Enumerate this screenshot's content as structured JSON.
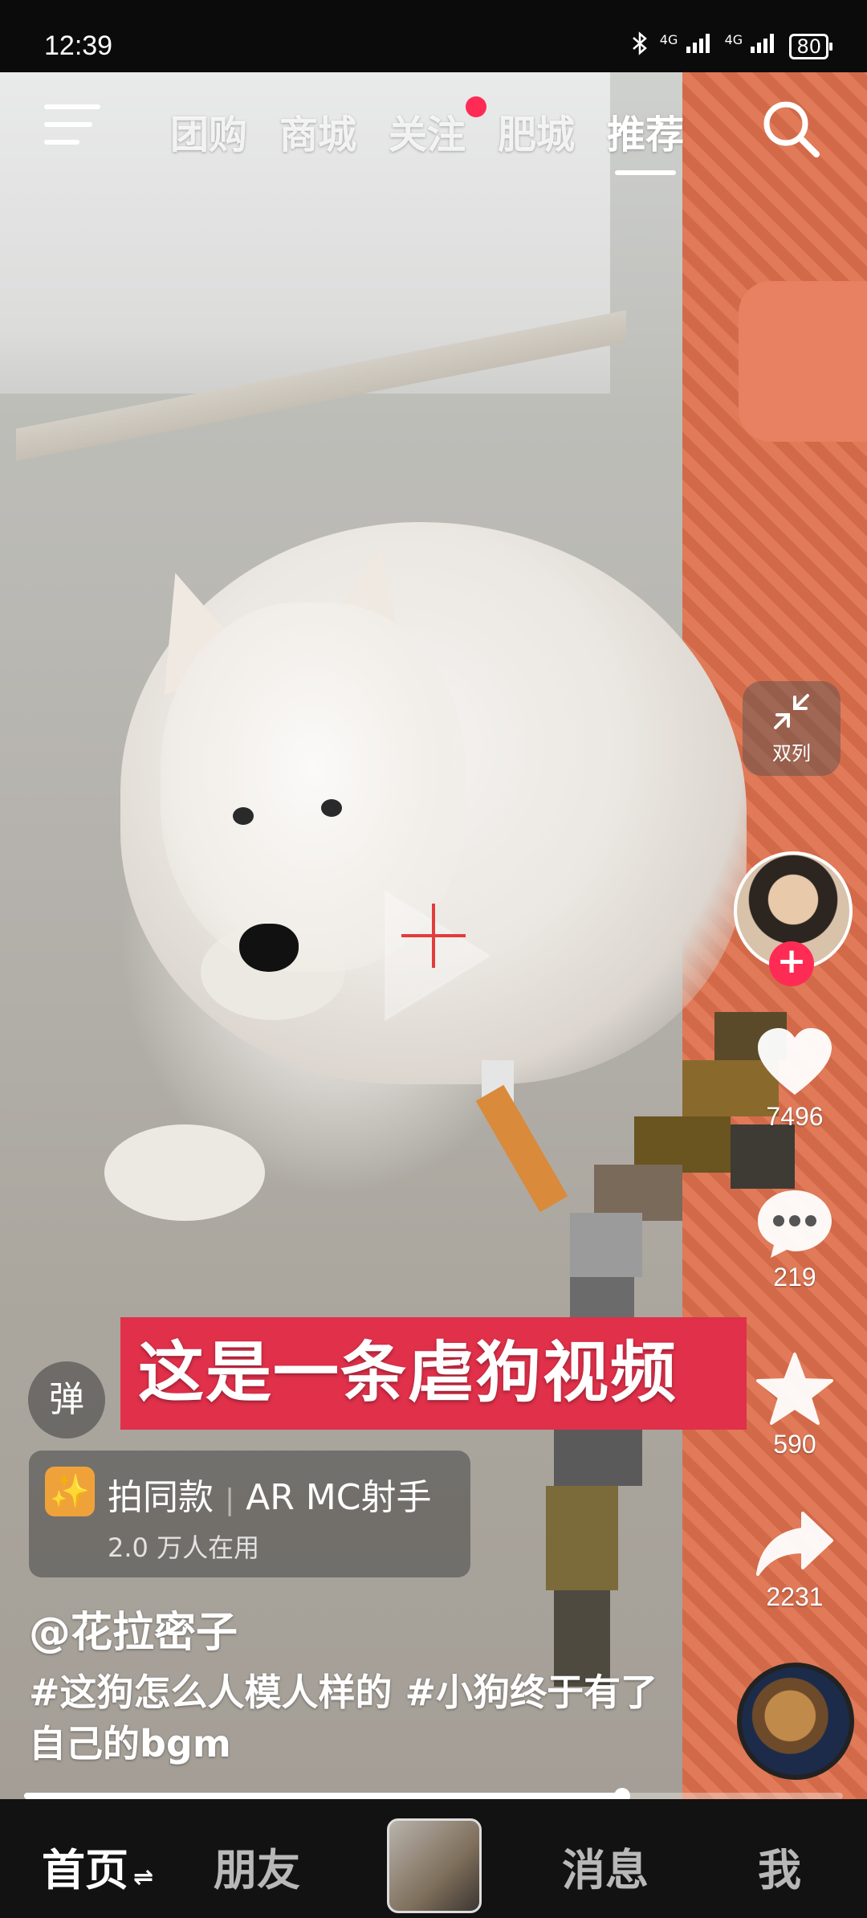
{
  "status_bar": {
    "time": "12:39",
    "signal1": "4G",
    "signal2": "4G",
    "battery": "80"
  },
  "top_nav": {
    "tabs": [
      {
        "label": "团购"
      },
      {
        "label": "商城"
      },
      {
        "label": "关注"
      },
      {
        "label": "肥城"
      },
      {
        "label": "推荐"
      }
    ],
    "active_tab": "推荐"
  },
  "dual_column": {
    "label": "双列"
  },
  "actions": {
    "likes": "7496",
    "comments": "219",
    "favorites": "590",
    "shares": "2231"
  },
  "danmu": {
    "label": "弹"
  },
  "banner": {
    "text": "这是一条虐狗视频"
  },
  "effect": {
    "icon": "✨",
    "prefix": "拍同款",
    "name": "AR MC射手",
    "usage": "2.0 万人在用"
  },
  "author": "@花拉密子",
  "caption": "#这狗怎么人模人样的 #小狗终于有了自己的bgm",
  "progress": {
    "fraction": 0.73
  },
  "bottom_nav": {
    "home": "首页",
    "home_swap": "⇌",
    "friends": "朋友",
    "messages": "消息",
    "me": "我"
  }
}
